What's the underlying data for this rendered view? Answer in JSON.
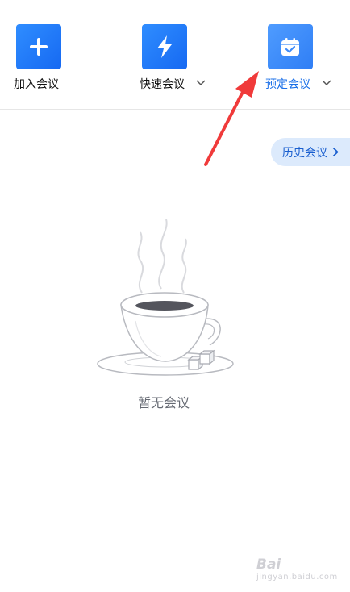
{
  "toolbar": {
    "actions": [
      {
        "label": "加入会议",
        "icon": "plus-icon",
        "dropdown": false
      },
      {
        "label": "快速会议",
        "icon": "lightning-icon",
        "dropdown": true
      },
      {
        "label": "预定会议",
        "icon": "calendar-check-icon",
        "dropdown": true,
        "active": true
      }
    ]
  },
  "history": {
    "label": "历史会议",
    "icon": "chevron-right-icon"
  },
  "empty_state": {
    "text": "暂无会议",
    "illustration": "coffee-cup-icon"
  },
  "annotation": {
    "icon": "red-arrow-icon"
  },
  "watermark": {
    "logo": "Bai",
    "site": "jingyan.baidu.com"
  },
  "colors": {
    "accent": "#1a6fe8",
    "tile": "#1669f2",
    "history_bg": "#dceafc",
    "arrow": "#f03a3a",
    "empty_text": "#666a73"
  }
}
